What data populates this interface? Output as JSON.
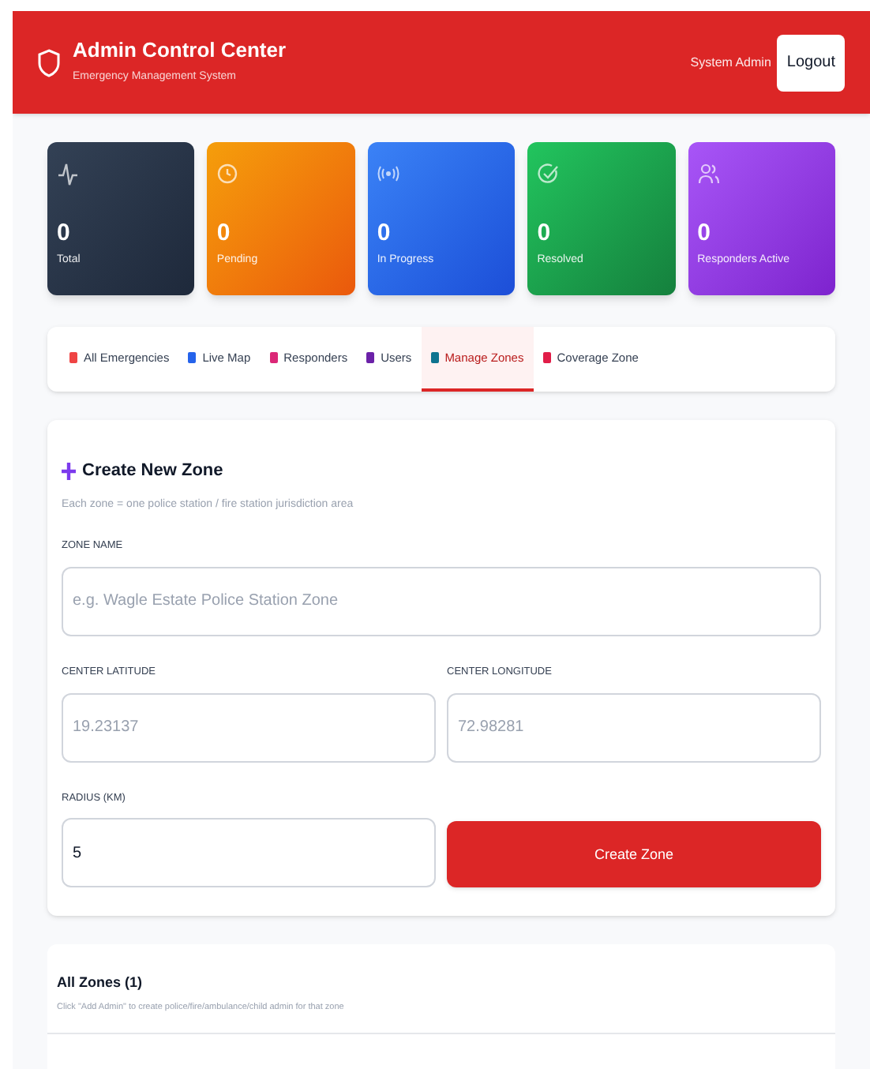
{
  "header": {
    "title": "Admin Control Center",
    "subtitle": "Emergency Management System",
    "user": "System Admin",
    "logout": "Logout"
  },
  "stats": [
    {
      "kind": "pulse",
      "value": "0",
      "label": "Total"
    },
    {
      "kind": "clock",
      "value": "0",
      "label": "Pending"
    },
    {
      "kind": "signal",
      "value": "0",
      "label": "In Progress"
    },
    {
      "kind": "check",
      "value": "0",
      "label": "Resolved"
    },
    {
      "kind": "users",
      "value": "0",
      "label": "Responders Active"
    }
  ],
  "tabs": [
    {
      "label": "All Emergencies",
      "selected": false,
      "color": "#ef4444"
    },
    {
      "label": "Live Map",
      "selected": false,
      "color": "#2563eb"
    },
    {
      "label": "Responders",
      "selected": false,
      "color": "#db2777"
    },
    {
      "label": "Users",
      "selected": false,
      "color": "#6b21a8"
    },
    {
      "label": "Manage Zones",
      "selected": true,
      "color": "#0e7490"
    },
    {
      "label": "Coverage Zone",
      "selected": false,
      "color": "#e11d48"
    }
  ],
  "create_zone": {
    "title": "Create New Zone",
    "description": "Each zone = one police station / fire station jurisdiction area",
    "fields": [
      {
        "label": "ZONE NAME",
        "placeholder": "e.g. Wagle Estate Police Station Zone"
      },
      {
        "label": "CENTER LATITUDE",
        "placeholder": "19.23137"
      },
      {
        "label": "CENTER LONGITUDE",
        "placeholder": "72.98281"
      },
      {
        "label": "RADIUS (KM)",
        "value": "5"
      }
    ],
    "button": "Create Zone"
  },
  "all_zones": {
    "title": "All Zones (1)",
    "description": "Click \"Add Admin\" to create police/fire/ambulance/child admin for that zone"
  }
}
